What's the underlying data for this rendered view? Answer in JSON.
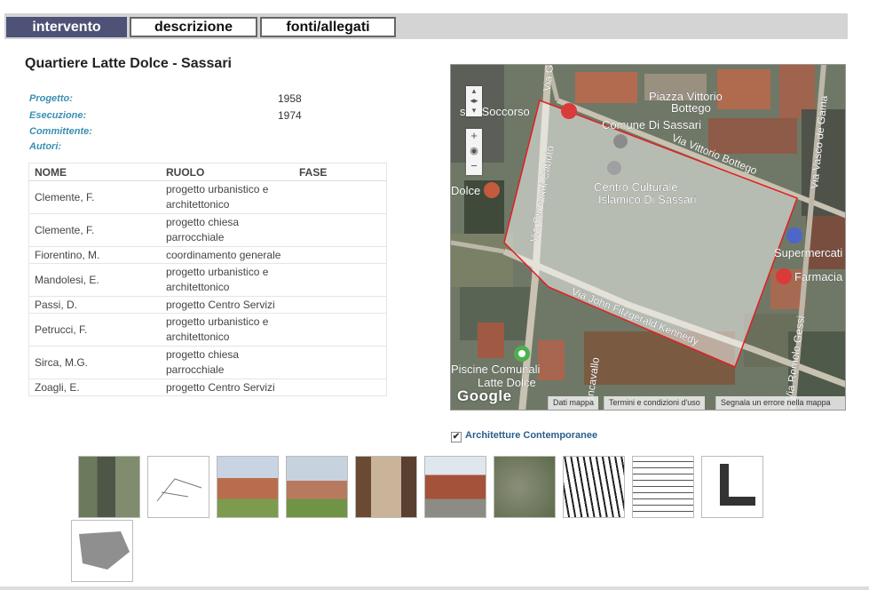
{
  "tabs": [
    {
      "label": "intervento",
      "active": true
    },
    {
      "label": "descrizione",
      "active": false
    },
    {
      "label": "fonti/allegati",
      "active": false
    }
  ],
  "title": "Quartiere Latte Dolce - Sassari",
  "meta": {
    "progetto_label": "Progetto:",
    "progetto_value": "1958",
    "esecuzione_label": "Esecuzione:",
    "esecuzione_value": "1974",
    "committente_label": "Committente:",
    "autori_label": "Autori:"
  },
  "authors_table": {
    "headers": [
      "NOME",
      "RUOLO",
      "FASE"
    ],
    "rows": [
      {
        "nome": "Clemente, F.",
        "ruolo_1": "progetto urbanistico e",
        "ruolo_2": "architettonico",
        "fase": ""
      },
      {
        "nome": "Clemente, F.",
        "ruolo_1": "progetto chiesa",
        "ruolo_2": "parrocchiale",
        "fase": ""
      },
      {
        "nome": "Fiorentino, M.",
        "ruolo_1": "coordinamento generale",
        "ruolo_2": "",
        "fase": ""
      },
      {
        "nome": "Mandolesi, E.",
        "ruolo_1": "progetto urbanistico e",
        "ruolo_2": "architettonico",
        "fase": ""
      },
      {
        "nome": "Passi, D.",
        "ruolo_1": "progetto Centro Servizi",
        "ruolo_2": "",
        "fase": ""
      },
      {
        "nome": "Petrucci, F.",
        "ruolo_1": "progetto urbanistico e",
        "ruolo_2": "architettonico",
        "fase": ""
      },
      {
        "nome": "Sirca, M.G.",
        "ruolo_1": "progetto chiesa",
        "ruolo_2": "parrocchiale",
        "fase": ""
      },
      {
        "nome": "Zoagli, E.",
        "ruolo_1": "progetto Centro Servizi",
        "ruolo_2": "",
        "fase": ""
      }
    ]
  },
  "map": {
    "labels": {
      "piazza": "Piazza Vittorio",
      "piazza2": "Bottego",
      "comune": "Comune Di Sassari",
      "socc": "sari Soccorso",
      "centro1": "Centro Culturale",
      "centro2": "Islamico Di Sassari",
      "via_bottego": "Via Vittorio Bottego",
      "via_caboto": "Via Giovanni Caboto",
      "via_kennedy": "Via John Fitzgerald Kennedy",
      "via_gessi": "Via Romolo Gessi",
      "via_gama": "Via Vasco de Gama",
      "via_g": "Via G",
      "dolce": "Dolce",
      "supermercati": "Supermercati",
      "farmacia": "Farmacia",
      "piscine1": "Piscine Comunali",
      "piscine2": "Latte Dolce",
      "roncavallo": "oncavallo"
    },
    "attribution": [
      "Dati mappa",
      "Termini e condizioni d'uso",
      "Segnala un errore nella mappa"
    ],
    "logo": "Google",
    "controls": {
      "zoom_in": "+",
      "zoom_out": "−"
    },
    "colors": {
      "outline": "#e02020",
      "overlay": "#ffffff"
    }
  },
  "checkbox": {
    "label": "Architetture Contemporanee",
    "checked": true,
    "mark": "✔"
  },
  "thumbnails": [
    "aerial-photo",
    "sketch-plan",
    "building-photo-1",
    "building-photo-2",
    "entrance-photo",
    "street-photo",
    "satellite-photo",
    "street-plan-drawing",
    "architectural-drawing",
    "l-shaped-plan",
    "site-plan"
  ]
}
